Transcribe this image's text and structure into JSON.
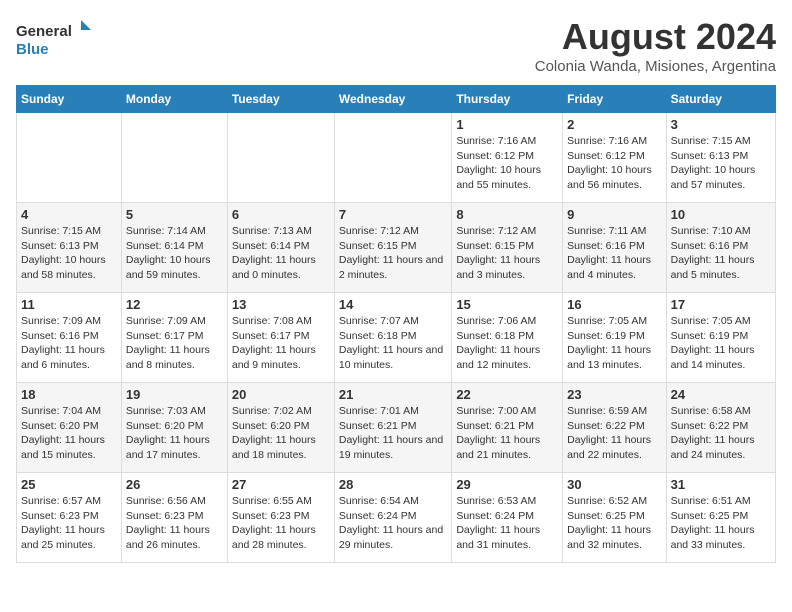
{
  "header": {
    "logo_line1": "General",
    "logo_line2": "Blue",
    "title": "August 2024",
    "subtitle": "Colonia Wanda, Misiones, Argentina"
  },
  "weekdays": [
    "Sunday",
    "Monday",
    "Tuesday",
    "Wednesday",
    "Thursday",
    "Friday",
    "Saturday"
  ],
  "weeks": [
    [
      {
        "day": "",
        "info": ""
      },
      {
        "day": "",
        "info": ""
      },
      {
        "day": "",
        "info": ""
      },
      {
        "day": "",
        "info": ""
      },
      {
        "day": "1",
        "info": "Sunrise: 7:16 AM\nSunset: 6:12 PM\nDaylight: 10 hours and 55 minutes."
      },
      {
        "day": "2",
        "info": "Sunrise: 7:16 AM\nSunset: 6:12 PM\nDaylight: 10 hours and 56 minutes."
      },
      {
        "day": "3",
        "info": "Sunrise: 7:15 AM\nSunset: 6:13 PM\nDaylight: 10 hours and 57 minutes."
      }
    ],
    [
      {
        "day": "4",
        "info": "Sunrise: 7:15 AM\nSunset: 6:13 PM\nDaylight: 10 hours and 58 minutes."
      },
      {
        "day": "5",
        "info": "Sunrise: 7:14 AM\nSunset: 6:14 PM\nDaylight: 10 hours and 59 minutes."
      },
      {
        "day": "6",
        "info": "Sunrise: 7:13 AM\nSunset: 6:14 PM\nDaylight: 11 hours and 0 minutes."
      },
      {
        "day": "7",
        "info": "Sunrise: 7:12 AM\nSunset: 6:15 PM\nDaylight: 11 hours and 2 minutes."
      },
      {
        "day": "8",
        "info": "Sunrise: 7:12 AM\nSunset: 6:15 PM\nDaylight: 11 hours and 3 minutes."
      },
      {
        "day": "9",
        "info": "Sunrise: 7:11 AM\nSunset: 6:16 PM\nDaylight: 11 hours and 4 minutes."
      },
      {
        "day": "10",
        "info": "Sunrise: 7:10 AM\nSunset: 6:16 PM\nDaylight: 11 hours and 5 minutes."
      }
    ],
    [
      {
        "day": "11",
        "info": "Sunrise: 7:09 AM\nSunset: 6:16 PM\nDaylight: 11 hours and 6 minutes."
      },
      {
        "day": "12",
        "info": "Sunrise: 7:09 AM\nSunset: 6:17 PM\nDaylight: 11 hours and 8 minutes."
      },
      {
        "day": "13",
        "info": "Sunrise: 7:08 AM\nSunset: 6:17 PM\nDaylight: 11 hours and 9 minutes."
      },
      {
        "day": "14",
        "info": "Sunrise: 7:07 AM\nSunset: 6:18 PM\nDaylight: 11 hours and 10 minutes."
      },
      {
        "day": "15",
        "info": "Sunrise: 7:06 AM\nSunset: 6:18 PM\nDaylight: 11 hours and 12 minutes."
      },
      {
        "day": "16",
        "info": "Sunrise: 7:05 AM\nSunset: 6:19 PM\nDaylight: 11 hours and 13 minutes."
      },
      {
        "day": "17",
        "info": "Sunrise: 7:05 AM\nSunset: 6:19 PM\nDaylight: 11 hours and 14 minutes."
      }
    ],
    [
      {
        "day": "18",
        "info": "Sunrise: 7:04 AM\nSunset: 6:20 PM\nDaylight: 11 hours and 15 minutes."
      },
      {
        "day": "19",
        "info": "Sunrise: 7:03 AM\nSunset: 6:20 PM\nDaylight: 11 hours and 17 minutes."
      },
      {
        "day": "20",
        "info": "Sunrise: 7:02 AM\nSunset: 6:20 PM\nDaylight: 11 hours and 18 minutes."
      },
      {
        "day": "21",
        "info": "Sunrise: 7:01 AM\nSunset: 6:21 PM\nDaylight: 11 hours and 19 minutes."
      },
      {
        "day": "22",
        "info": "Sunrise: 7:00 AM\nSunset: 6:21 PM\nDaylight: 11 hours and 21 minutes."
      },
      {
        "day": "23",
        "info": "Sunrise: 6:59 AM\nSunset: 6:22 PM\nDaylight: 11 hours and 22 minutes."
      },
      {
        "day": "24",
        "info": "Sunrise: 6:58 AM\nSunset: 6:22 PM\nDaylight: 11 hours and 24 minutes."
      }
    ],
    [
      {
        "day": "25",
        "info": "Sunrise: 6:57 AM\nSunset: 6:23 PM\nDaylight: 11 hours and 25 minutes."
      },
      {
        "day": "26",
        "info": "Sunrise: 6:56 AM\nSunset: 6:23 PM\nDaylight: 11 hours and 26 minutes."
      },
      {
        "day": "27",
        "info": "Sunrise: 6:55 AM\nSunset: 6:23 PM\nDaylight: 11 hours and 28 minutes."
      },
      {
        "day": "28",
        "info": "Sunrise: 6:54 AM\nSunset: 6:24 PM\nDaylight: 11 hours and 29 minutes."
      },
      {
        "day": "29",
        "info": "Sunrise: 6:53 AM\nSunset: 6:24 PM\nDaylight: 11 hours and 31 minutes."
      },
      {
        "day": "30",
        "info": "Sunrise: 6:52 AM\nSunset: 6:25 PM\nDaylight: 11 hours and 32 minutes."
      },
      {
        "day": "31",
        "info": "Sunrise: 6:51 AM\nSunset: 6:25 PM\nDaylight: 11 hours and 33 minutes."
      }
    ]
  ]
}
